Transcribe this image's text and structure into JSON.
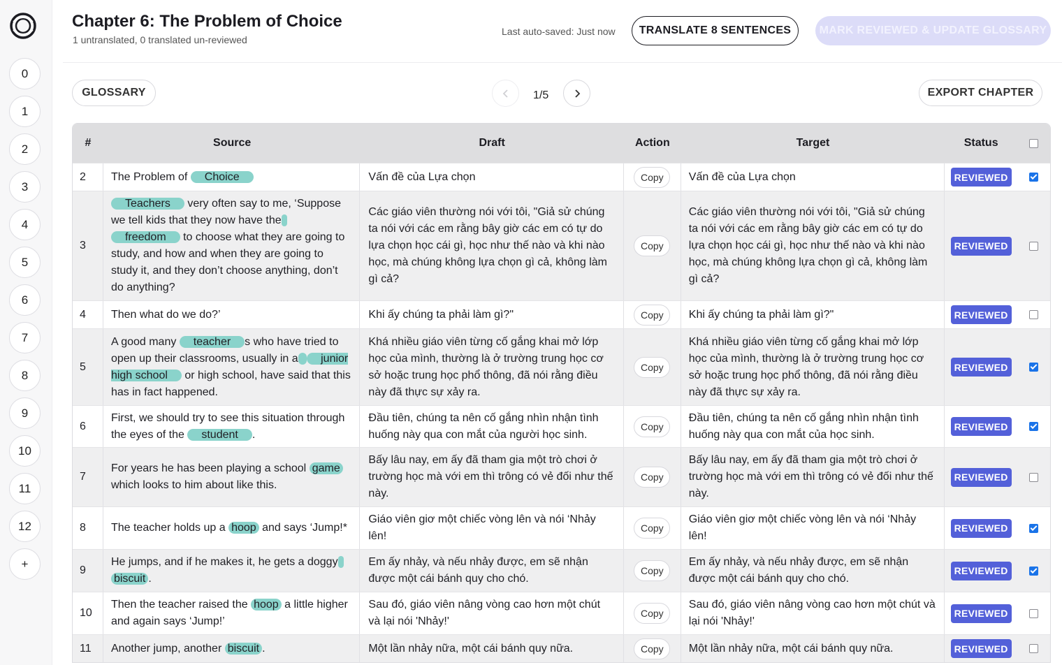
{
  "sidebar": {
    "chapters": [
      "0",
      "1",
      "2",
      "3",
      "4",
      "5",
      "6",
      "7",
      "8",
      "9",
      "10",
      "11",
      "12"
    ],
    "add_label": "+"
  },
  "header": {
    "title": "Chapter 6: The Problem of Choice",
    "subtitle": "1 untranslated, 0 translated un-reviewed",
    "autosave": "Last auto-saved: Just now",
    "translate_label": "TRANSLATE 8 SENTENCES",
    "mark_label": "MARK REVIEWED & UPDATE GLOSSARY"
  },
  "toolbar": {
    "glossary_label": "GLOSSARY",
    "page_indicator": "1/5",
    "export_label": "EXPORT CHAPTER"
  },
  "table": {
    "headers": {
      "num": "#",
      "source": "Source",
      "draft": "Draft",
      "action": "Action",
      "target": "Target",
      "status": "Status"
    },
    "copy_label": "Copy",
    "rows": [
      {
        "num": "2",
        "source": [
          {
            "t": "The Problem of "
          },
          {
            "t": "Choice",
            "h": "wide"
          }
        ],
        "draft": "Vấn đề của Lựa chọn",
        "target": "Vấn đề của Lựa chọn",
        "status": "REVIEWED",
        "checked": true
      },
      {
        "num": "3",
        "source": [
          {
            "t": "Teachers",
            "h": "wide"
          },
          {
            "t": " very often say to me, ‘Suppose we tell kids that they now have the"
          },
          {
            "t": " ",
            "h": "n"
          },
          {
            "t": " "
          },
          {
            "t": "freedom",
            "h": "wide"
          },
          {
            "t": " to choose what they are going to study, and how and when they are going to study it, and they don’t choose anything, don’t do anything?"
          }
        ],
        "draft": "Các giáo viên thường nói với tôi, \"Giả sử chúng ta nói với các em rằng bây giờ các em có tự do lựa chọn học cái gì, học như thế nào và khi nào học, mà chúng không lựa chọn gì cả, không làm gì cả?",
        "target": "Các giáo viên thường nói với tôi, \"Giả sử chúng ta nói với các em rằng bây giờ các em có tự do lựa chọn học cái gì, học như thế nào và khi nào học, mà chúng không lựa chọn gì cả, không làm gì cả?",
        "status": "REVIEWED",
        "checked": false
      },
      {
        "num": "4",
        "source": [
          {
            "t": "Then what do we do?’"
          }
        ],
        "draft": "Khi ấy chúng ta phải làm gì?\"",
        "target": "Khi ấy chúng ta phải làm gì?\"",
        "status": "REVIEWED",
        "checked": false
      },
      {
        "num": "5",
        "source": [
          {
            "t": "A good many "
          },
          {
            "t": "teacher",
            "h": "wide"
          },
          {
            "t": "s who have tried to open up their classrooms, usually in a"
          },
          {
            "t": " ",
            "h": "n"
          },
          {
            "t": " "
          },
          {
            "t": "junior    high school",
            "h": "wide"
          },
          {
            "t": " or high school, have said that this has in fact happened."
          }
        ],
        "draft": "Khá nhiều giáo viên từng cố gắng khai mở lớp học của mình, thường là ở trường trung học cơ sở hoặc trung học phổ thông, đã nói rằng điều này đã thực sự xảy ra.",
        "target": "Khá nhiều giáo viên từng cố gắng khai mở lớp học của mình, thường là ở trường trung học cơ sở hoặc trung học phổ thông, đã nói rằng điều này đã thực sự xảy ra.",
        "status": "REVIEWED",
        "checked": true
      },
      {
        "num": "6",
        "source": [
          {
            "t": "First, we should try to see this situation through the eyes of the "
          },
          {
            "t": "student",
            "h": "wide"
          },
          {
            "t": "."
          }
        ],
        "draft": "Đầu tiên, chúng ta nên cố gắng nhìn nhận tình huống này qua con mắt của người học sinh.",
        "target": "Đầu tiên, chúng ta nên cố gắng nhìn nhận tình huống này qua con mắt của học sinh.",
        "status": "REVIEWED",
        "checked": true
      },
      {
        "num": "7",
        "source": [
          {
            "t": "For years he has been playing a school "
          },
          {
            "t": "game",
            "h": "n"
          },
          {
            "t": " which looks to him about like this."
          }
        ],
        "draft": "Bấy lâu nay, em ấy đã tham gia một trò chơi ở trường học mà với em thì trông có vẻ đối như thế này.",
        "target": "Bấy lâu nay, em ấy đã tham gia một trò chơi ở trường học mà với em thì trông có vẻ đối như thế này.",
        "status": "REVIEWED",
        "checked": false
      },
      {
        "num": "8",
        "source": [
          {
            "t": "The teacher holds up a "
          },
          {
            "t": "hoop",
            "h": "n"
          },
          {
            "t": " and says ‘Jump!*"
          }
        ],
        "draft": "Giáo viên giơ một chiếc vòng lên và nói ‘Nhảy lên!",
        "target": "Giáo viên giơ một chiếc vòng lên và nói ‘Nhảy lên!",
        "status": "REVIEWED",
        "checked": true
      },
      {
        "num": "9",
        "source": [
          {
            "t": "He jumps, and if he makes it, he gets a doggy"
          },
          {
            "t": " ",
            "h": "n"
          },
          {
            "t": " "
          },
          {
            "t": "biscuit",
            "h": "n"
          },
          {
            "t": "."
          }
        ],
        "draft": "Em ấy nhảy, và nếu nhảy được, em sẽ nhận được một cái bánh quy cho chó.",
        "target": "Em ấy nhảy, và nếu nhảy được, em sẽ nhận được một cái bánh quy cho chó.",
        "status": "REVIEWED",
        "checked": true
      },
      {
        "num": "10",
        "source": [
          {
            "t": "Then the teacher raised the "
          },
          {
            "t": "hoop",
            "h": "n"
          },
          {
            "t": " a little higher and again says ‘Jump!’"
          }
        ],
        "draft": "Sau đó, giáo viên nâng vòng cao hơn một chút và lại nói 'Nhảy!'",
        "target": "Sau đó, giáo viên nâng vòng cao hơn một chút và lại nói 'Nhảy!'",
        "status": "REVIEWED",
        "checked": false
      },
      {
        "num": "11",
        "source": [
          {
            "t": "Another jump, another "
          },
          {
            "t": "biscuit",
            "h": "n"
          },
          {
            "t": "."
          }
        ],
        "draft": "Một lần nhảy nữa, một cái bánh quy nữa.",
        "target": "Một lần nhảy nữa, một cái bánh quy nữa.",
        "status": "REVIEWED",
        "checked": false
      }
    ]
  }
}
